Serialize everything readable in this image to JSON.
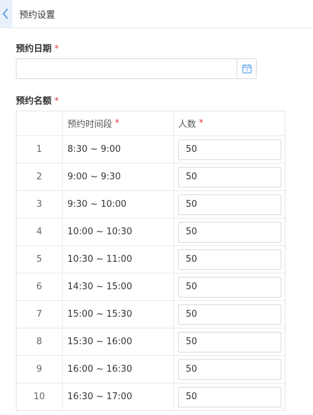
{
  "header": {
    "title": "预约设置"
  },
  "form": {
    "date_label": "预约日期",
    "date_value": "",
    "quota_label": "预约名额",
    "required_mark": "*"
  },
  "table": {
    "columns": [
      "",
      "预约时间段",
      "人数"
    ],
    "rows": [
      {
        "index": "1",
        "time": "8:30 ~ 9:00",
        "count": "50"
      },
      {
        "index": "2",
        "time": "9:00 ~ 9:30",
        "count": "50"
      },
      {
        "index": "3",
        "time": "9:30 ~ 10:00",
        "count": "50"
      },
      {
        "index": "4",
        "time": "10:00 ~ 10:30",
        "count": "50"
      },
      {
        "index": "5",
        "time": "10:30 ~ 11:00",
        "count": "50"
      },
      {
        "index": "6",
        "time": "14:30 ~ 15:00",
        "count": "50"
      },
      {
        "index": "7",
        "time": "15:00 ~ 15:30",
        "count": "50"
      },
      {
        "index": "8",
        "time": "15:30 ~ 16:00",
        "count": "50"
      },
      {
        "index": "9",
        "time": "16:00 ~ 16:30",
        "count": "50"
      },
      {
        "index": "10",
        "time": "16:30 ~ 17:00",
        "count": "50"
      }
    ]
  },
  "icons": {
    "back": "chevron-left-icon",
    "calendar": "calendar-icon"
  },
  "colors": {
    "accent": "#3a8ee6",
    "required": "#e0393e",
    "back_bg": "#e8f1fb"
  }
}
